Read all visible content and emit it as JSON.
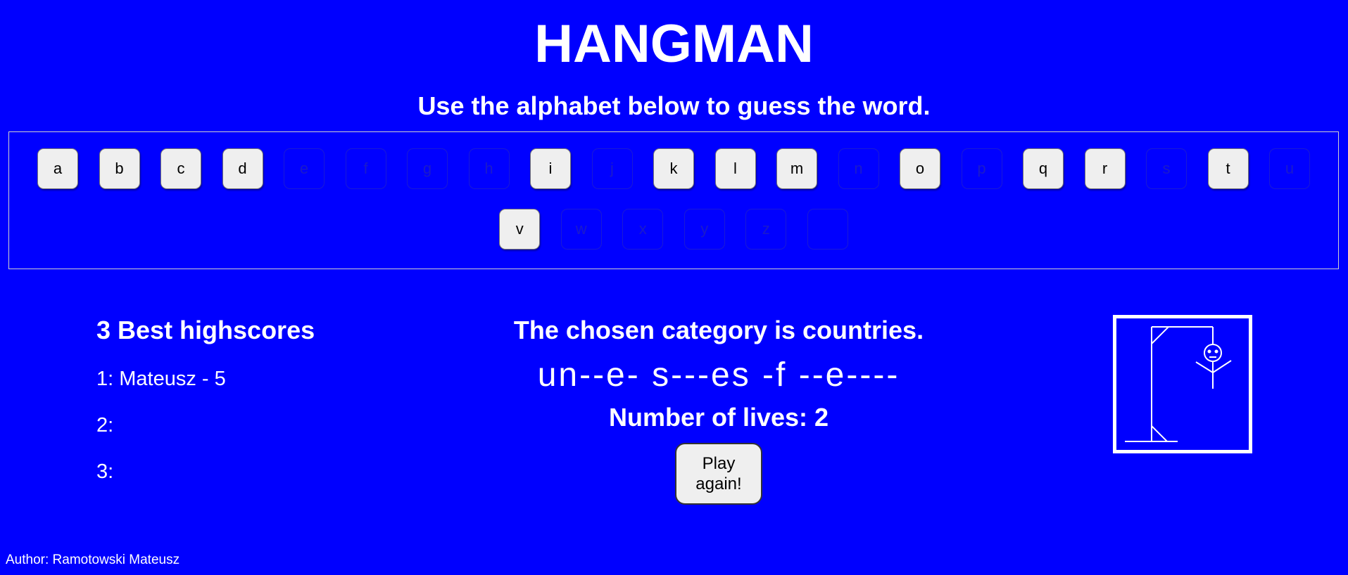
{
  "header": {
    "title": "HANGMAN",
    "subtitle": "Use the alphabet below to guess the word."
  },
  "alphabet": [
    {
      "letter": "a",
      "used": false
    },
    {
      "letter": "b",
      "used": false
    },
    {
      "letter": "c",
      "used": false
    },
    {
      "letter": "d",
      "used": false
    },
    {
      "letter": "e",
      "used": true
    },
    {
      "letter": "f",
      "used": true
    },
    {
      "letter": "g",
      "used": true
    },
    {
      "letter": "h",
      "used": true
    },
    {
      "letter": "i",
      "used": false
    },
    {
      "letter": "j",
      "used": true
    },
    {
      "letter": "k",
      "used": false
    },
    {
      "letter": "l",
      "used": false
    },
    {
      "letter": "m",
      "used": false
    },
    {
      "letter": "n",
      "used": true
    },
    {
      "letter": "o",
      "used": false
    },
    {
      "letter": "p",
      "used": true
    },
    {
      "letter": "q",
      "used": false
    },
    {
      "letter": "r",
      "used": false
    },
    {
      "letter": "s",
      "used": true
    },
    {
      "letter": "t",
      "used": false
    },
    {
      "letter": "u",
      "used": true
    },
    {
      "letter": "v",
      "used": false
    },
    {
      "letter": "w",
      "used": true
    },
    {
      "letter": "x",
      "used": true
    },
    {
      "letter": "y",
      "used": true
    },
    {
      "letter": "z",
      "used": true
    },
    {
      "letter": "",
      "used": true
    }
  ],
  "highscores": {
    "title": "3 Best highscores",
    "rows": [
      "1: Mateusz - 5",
      "2:",
      "3:"
    ]
  },
  "game": {
    "category_text": "The chosen category is countries.",
    "masked_word": "un--e- s---es -f --e----",
    "lives_text": "Number of lives: 2",
    "play_again_label": "Play again!"
  },
  "footer": {
    "author": "Author: Ramotowski Mateusz"
  }
}
